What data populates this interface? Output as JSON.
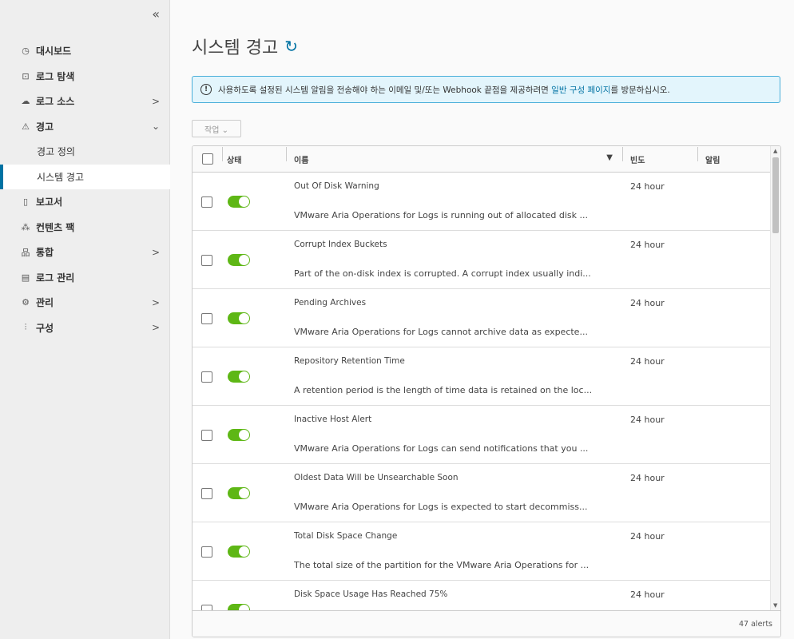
{
  "sidebar": {
    "collapse_icon": "«",
    "items": [
      {
        "icon": "dashboard-icon",
        "glyph": "◷",
        "label": "대시보드",
        "chevron": ""
      },
      {
        "icon": "explore-logs-icon",
        "glyph": "⊡",
        "label": "로그 탐색",
        "chevron": ""
      },
      {
        "icon": "cloud-icon",
        "glyph": "☁",
        "label": "로그 소스",
        "chevron": ">"
      },
      {
        "icon": "warning-icon",
        "glyph": "⚠",
        "label": "경고",
        "chevron": "⌄"
      }
    ],
    "sub_items": [
      {
        "label": "경고 정의",
        "active": false
      },
      {
        "label": "시스템 경고",
        "active": true
      }
    ],
    "items_after": [
      {
        "icon": "report-icon",
        "glyph": "▯",
        "label": "보고서",
        "chevron": ""
      },
      {
        "icon": "content-pack-icon",
        "glyph": "⁂",
        "label": "컨텐츠 팩",
        "chevron": ""
      },
      {
        "icon": "integration-icon",
        "glyph": "品",
        "label": "통합",
        "chevron": ">"
      },
      {
        "icon": "log-management-icon",
        "glyph": "▤",
        "label": "로그 관리",
        "chevron": ""
      },
      {
        "icon": "gear-icon",
        "glyph": "⚙",
        "label": "관리",
        "chevron": ">"
      },
      {
        "icon": "sliders-icon",
        "glyph": "⫶",
        "label": "구성",
        "chevron": ">"
      }
    ]
  },
  "page": {
    "title": "시스템 경고",
    "refresh_icon": "refresh-icon"
  },
  "banner": {
    "icon": "info-icon",
    "text_before": "사용하도록 설정된 시스템 알림을 전송해야 하는 이메일 및/또는 Webhook 끝점을 제공하려면 ",
    "link": "일반 구성 페이지",
    "text_after": "를 방문하십시오."
  },
  "actions": {
    "label": "작업 ⌄"
  },
  "table": {
    "headers": {
      "status": "상태",
      "name": "이름",
      "frequency": "빈도",
      "alert": "알림"
    },
    "rows": [
      {
        "name": "Out Of Disk Warning",
        "desc": "VMware Aria Operations for Logs is running out of allocated disk ...",
        "freq": "24 hour",
        "enabled": true
      },
      {
        "name": "Corrupt Index Buckets",
        "desc": "Part of the on-disk index is corrupted. A corrupt index usually indi...",
        "freq": "24 hour",
        "enabled": true
      },
      {
        "name": "Pending Archives",
        "desc": "VMware Aria Operations for Logs cannot archive data as expecte...",
        "freq": "24 hour",
        "enabled": true
      },
      {
        "name": "Repository Retention Time",
        "desc": "A retention period is the length of time data is retained on the loc...",
        "freq": "24 hour",
        "enabled": true
      },
      {
        "name": "Inactive Host Alert",
        "desc": "VMware Aria Operations for Logs can send notifications that you ...",
        "freq": "24 hour",
        "enabled": true
      },
      {
        "name": "Oldest Data Will be Unsearchable Soon",
        "desc": "VMware Aria Operations for Logs is expected to start decommiss...",
        "freq": "24 hour",
        "enabled": true
      },
      {
        "name": "Total Disk Space Change",
        "desc": "The total size of the partition for the VMware Aria Operations for ...",
        "freq": "24 hour",
        "enabled": true
      },
      {
        "name": "Disk Space Usage Has Reached 75%",
        "desc": "",
        "freq": "24 hour",
        "enabled": true
      }
    ],
    "footer": "47 alerts"
  }
}
